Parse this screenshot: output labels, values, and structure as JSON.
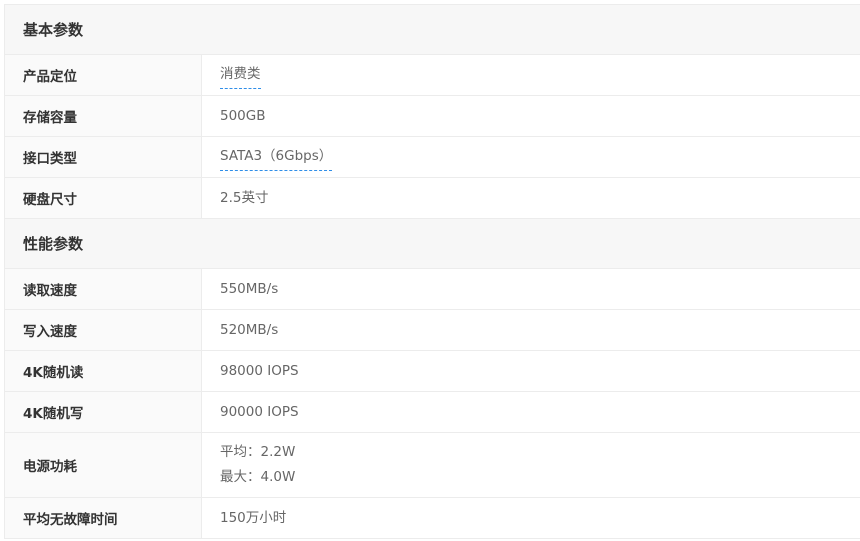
{
  "sections": [
    {
      "title": "基本参数",
      "rows": [
        {
          "label": "产品定位",
          "values": [
            "消费类"
          ],
          "link": true
        },
        {
          "label": "存储容量",
          "values": [
            "500GB"
          ],
          "link": false
        },
        {
          "label": "接口类型",
          "values": [
            "SATA3（6Gbps）"
          ],
          "link": true
        },
        {
          "label": "硬盘尺寸",
          "values": [
            "2.5英寸"
          ],
          "link": false
        }
      ]
    },
    {
      "title": "性能参数",
      "rows": [
        {
          "label": "读取速度",
          "values": [
            "550MB/s"
          ],
          "link": false
        },
        {
          "label": "写入速度",
          "values": [
            "520MB/s"
          ],
          "link": false
        },
        {
          "label": "4K随机读",
          "values": [
            "98000 IOPS"
          ],
          "link": false
        },
        {
          "label": "4K随机写",
          "values": [
            "90000 IOPS"
          ],
          "link": false
        },
        {
          "label": "电源功耗",
          "values": [
            "平均：2.2W",
            "最大：4.0W"
          ],
          "link": false
        },
        {
          "label": "平均无故障时间",
          "values": [
            "150万小时"
          ],
          "link": false
        }
      ]
    }
  ]
}
